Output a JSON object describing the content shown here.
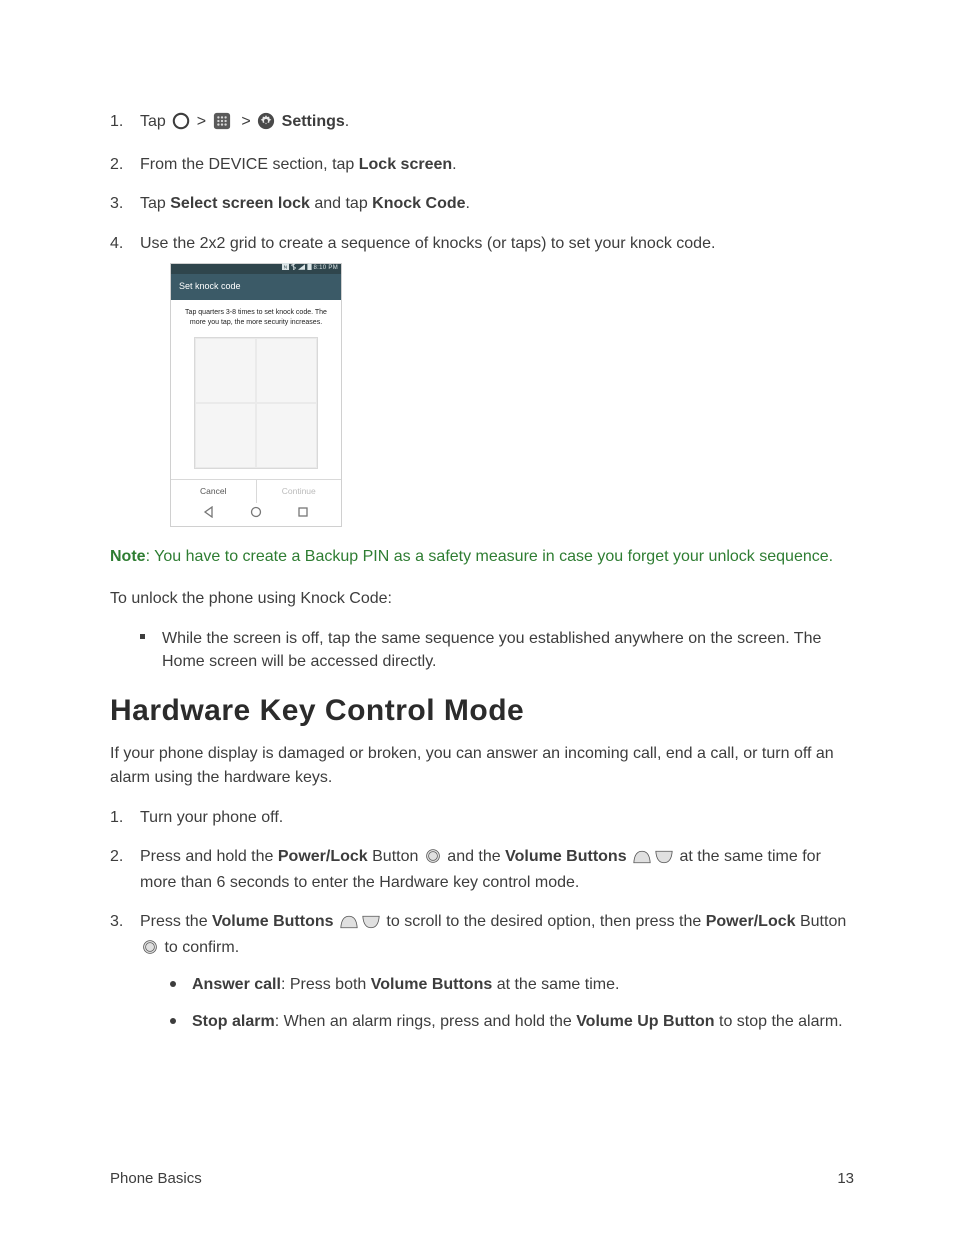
{
  "steps_a": {
    "s1": {
      "tap": "Tap",
      "sep": ">",
      "settings_bold": "Settings",
      "end": "."
    },
    "s2": {
      "pre": "From the DEVICE section, tap ",
      "bold": "Lock screen",
      "post": "."
    },
    "s3": {
      "pre": "Tap ",
      "bold1": "Select screen lock",
      "mid": " and tap ",
      "bold2": "Knock Code",
      "post": "."
    },
    "s4": "Use the 2x2 grid to create a sequence of knocks (or taps) to set your knock code."
  },
  "phone": {
    "status_time": "8:10 PM",
    "title": "Set knock code",
    "instr": "Tap quarters 3-8 times to set knock code. The more you tap, the more security increases.",
    "cancel": "Cancel",
    "continue": "Continue"
  },
  "note": {
    "label": "Note",
    "text": ": You have to create a Backup PIN as a safety measure in case you forget your unlock sequence."
  },
  "unlock_intro": "To unlock the phone using Knock Code:",
  "unlock_bullet": "While the screen is off, tap the same sequence you established anywhere on the screen. The Home screen will be accessed directly.",
  "h2": "Hardware Key Control Mode",
  "h2_para": "If your phone display is damaged or broken, you can answer an incoming call, end a call, or turn off an alarm using the hardware keys.",
  "steps_b": {
    "s1": "Turn your phone off.",
    "s2": {
      "pre": "Press and hold the ",
      "b1": "Power/Lock",
      "mid1": " Button ",
      "mid2": " and the ",
      "b2": "Volume Buttons",
      "post": " at the same time for more than 6 seconds to enter the Hardware key control mode."
    },
    "s3": {
      "pre": "Press the ",
      "b1": "Volume Buttons",
      "mid1": " to scroll to the desired option, then press the ",
      "b2": "Power/Lock",
      "mid2": " Button ",
      "post": " to confirm."
    },
    "a": {
      "b": "Answer call",
      "t1": ": Press both ",
      "b2": "Volume Buttons",
      "t2": " at the same time."
    },
    "b": {
      "b": "Stop alarm",
      "t1": ": When an alarm rings, press and hold the ",
      "b2": "Volume Up Button",
      "t2": " to stop the alarm."
    }
  },
  "footer": {
    "section": "Phone Basics",
    "page": "13"
  }
}
